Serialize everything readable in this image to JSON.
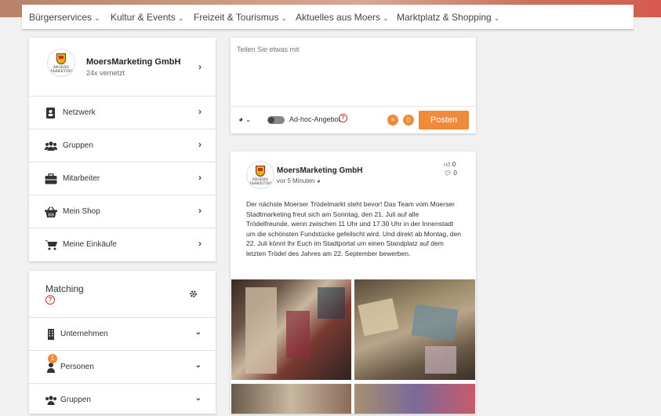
{
  "nav": {
    "items": [
      {
        "label": "Bürgerservices"
      },
      {
        "label": "Kultur & Events"
      },
      {
        "label": "Freizeit & Tourismus"
      },
      {
        "label": "Aktuelles aus Moers"
      },
      {
        "label": "Marktplatz & Shopping"
      }
    ]
  },
  "profile": {
    "name": "MoersMarketing GmbH",
    "connections": "24x vernetzt",
    "logo_text": "MOERS MARKETING"
  },
  "menu": [
    {
      "label": "Netzwerk",
      "icon": "address-book-icon"
    },
    {
      "label": "Gruppen",
      "icon": "users-icon"
    },
    {
      "label": "Mitarbeiter",
      "icon": "briefcase-icon"
    },
    {
      "label": "Mein Shop",
      "icon": "basket-icon"
    },
    {
      "label": "Meine Einkäufe",
      "icon": "cart-icon"
    }
  ],
  "matching": {
    "title": "Matching",
    "items": [
      {
        "label": "Unternehmen",
        "icon": "building-icon",
        "badge": ""
      },
      {
        "label": "Personen",
        "icon": "person-icon",
        "badge": "1"
      },
      {
        "label": "Gruppen",
        "icon": "users-icon",
        "badge": ""
      }
    ]
  },
  "composer": {
    "placeholder": "Teilen Sie etwas mit",
    "adhoc_label": "Ad-hoc-Angebot",
    "post_button": "Posten"
  },
  "post": {
    "author": "MoersMarketing GmbH",
    "time": "vor 5 Minuten",
    "likes": "0",
    "comments": "0",
    "text": "Der nächste Moerser Trödelmarkt steht bevor! Das Team vom Moerser Stadtmarketing freut sich am Sonntag, den 21. Juli auf alle Trödelfreunde, wenn zwischen 11 Uhr und 17.30 Uhr in der Innenstadt um die schönsten Fundstücke gefeilscht wird. Und direkt ab Montag, den 22. Juli könnt Ihr Euch im Stadtportal um einen Standplatz auf dem letzten Trödel des Jahres am 22. September bewerben."
  },
  "colors": {
    "accent": "#f08a3c",
    "help": "#c0392b"
  }
}
